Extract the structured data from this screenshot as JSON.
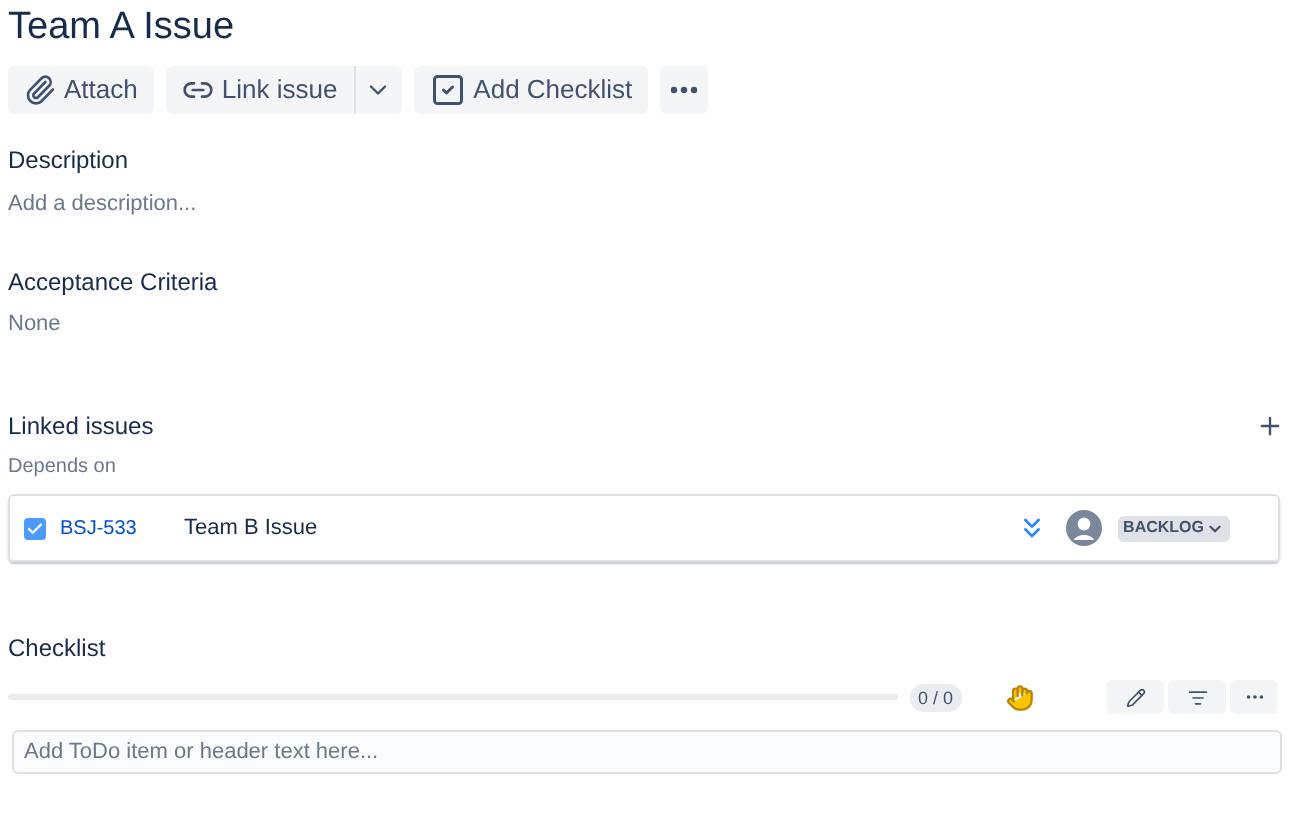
{
  "title": "Team A Issue",
  "toolbar": [
    {
      "kind": "attach",
      "label": "Attach"
    },
    {
      "kind": "link",
      "label": "Link issue"
    },
    {
      "kind": "dropdown"
    },
    {
      "kind": "checklist",
      "label": "Add Checklist"
    },
    {
      "kind": "more"
    }
  ],
  "description": {
    "label": "Description",
    "placeholder": "Add a description..."
  },
  "acceptance_criteria": {
    "label": "Acceptance Criteria",
    "value": "None"
  },
  "linked_issues": {
    "label": "Linked issues",
    "relation": "Depends on",
    "items": [
      {
        "checked": true,
        "key": "BSJ-533",
        "summary": "Team B Issue",
        "status": "BACKLOG"
      }
    ]
  },
  "checklist": {
    "label": "Checklist",
    "level": 0,
    "count": "0 / 0",
    "input_placeholder": "Add ToDo item or header text here..."
  }
}
